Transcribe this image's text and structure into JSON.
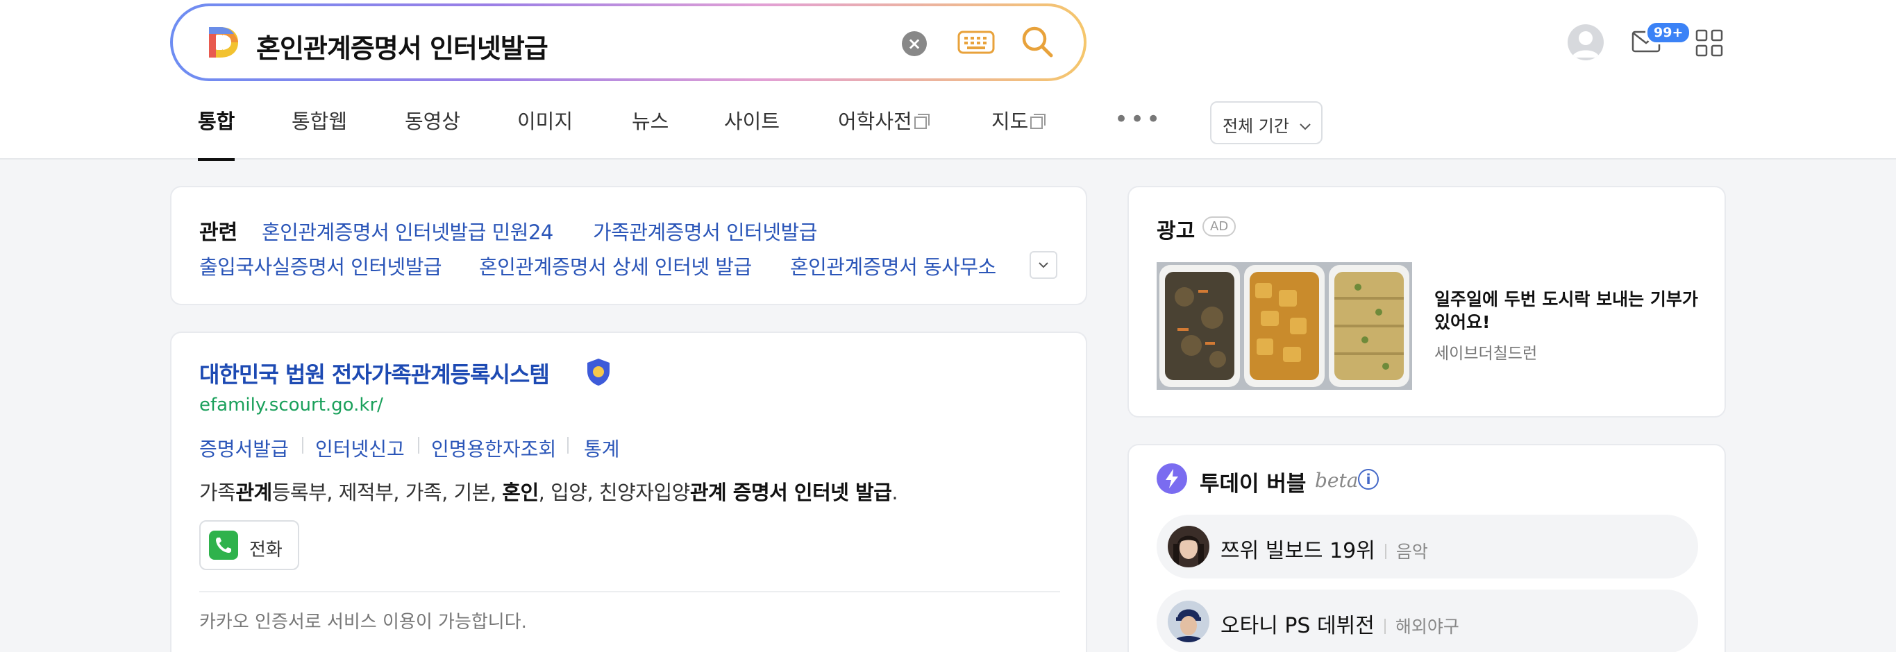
{
  "search": {
    "query": "혼인관계증명서 인터넷발급",
    "clear_symbol": "×"
  },
  "header": {
    "mail_badge": "99+"
  },
  "tabs": [
    {
      "label": "통합",
      "active": true
    },
    {
      "label": "통합웹"
    },
    {
      "label": "동영상"
    },
    {
      "label": "이미지"
    },
    {
      "label": "뉴스"
    },
    {
      "label": "사이트"
    },
    {
      "label": "어학사전",
      "external": true
    },
    {
      "label": "지도",
      "external": true
    }
  ],
  "more_tabs": "•••",
  "period_filter": {
    "label": "전체 기간"
  },
  "related": {
    "title": "관련",
    "links": [
      "혼인관계증명서 인터넷발급 민원24",
      "가족관계증명서 인터넷발급",
      "출입국사실증명서 인터넷발급",
      "혼인관계증명서 상세 인터넷 발급",
      "혼인관계증명서 동사무소"
    ]
  },
  "result": {
    "title": "대한민국 법원 전자가족관계등록시스템",
    "url": "efamily.scourt.go.kr/",
    "sublinks": [
      "증명서발급",
      "인터넷신고",
      "인명용한자조회",
      "통계"
    ],
    "snippet": {
      "s1": "가족",
      "b1": "관계",
      "s2": "등록부, 제적부, 가족, 기본, ",
      "b2": "혼인",
      "s3": ", 입양, 친양자입양",
      "b3": "관계 증명서 인터넷 발급",
      "s4": "."
    },
    "call_label": "전화",
    "note": "카카오 인증서로 서비스 이용이 가능합니다."
  },
  "ad": {
    "title": "광고",
    "badge": "AD",
    "text": "일주일에 두번 도시락 보내는 기부가 있어요!",
    "sponsor": "세이브더칠드런"
  },
  "today_bubble": {
    "title": "투데이 버블",
    "beta": "beta",
    "info": "i",
    "items": [
      {
        "label": "쯔위 빌보드 19위",
        "category": "음악"
      },
      {
        "label": "오타니 PS 데뷔전",
        "category": "해외야구"
      }
    ]
  },
  "colors": {
    "link_blue": "#2a55b8",
    "title_blue": "#1d4ab3",
    "url_green": "#1aa05b",
    "search_orange": "#e8a23b",
    "bubble_purple": "#7a6cf0"
  }
}
